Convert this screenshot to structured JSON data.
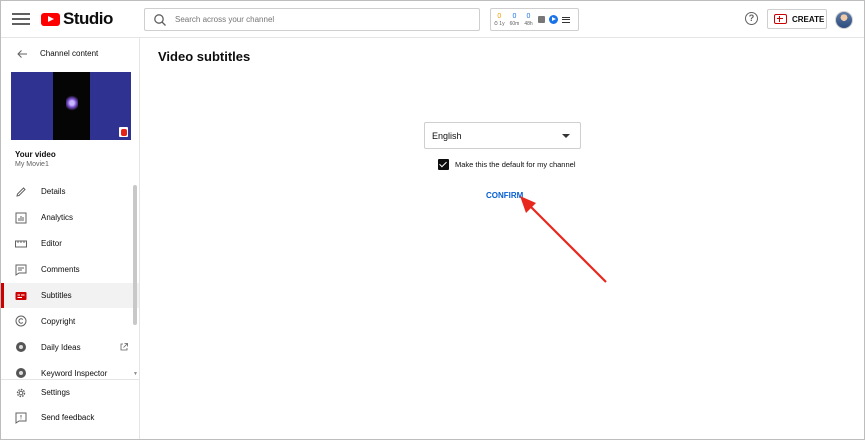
{
  "header": {
    "logo_text": "Studio",
    "search_placeholder": "Search across your channel",
    "stats": [
      {
        "value": "0",
        "label": "⏱ 1y",
        "color": "#f59b00"
      },
      {
        "value": "0",
        "label": "60m",
        "color": "#1a73e8"
      },
      {
        "value": "0",
        "label": "48h",
        "color": "#1a73e8"
      }
    ],
    "help_glyph": "?",
    "create_label": "CREATE"
  },
  "sidebar": {
    "back_label": "Channel content",
    "your_video_label": "Your video",
    "video_title": "My Movie1",
    "items": [
      {
        "label": "Details",
        "icon": "pencil-icon"
      },
      {
        "label": "Analytics",
        "icon": "analytics-icon"
      },
      {
        "label": "Editor",
        "icon": "editor-icon"
      },
      {
        "label": "Comments",
        "icon": "comments-icon"
      },
      {
        "label": "Subtitles",
        "icon": "subtitles-icon",
        "active": true
      },
      {
        "label": "Copyright",
        "icon": "copyright-icon"
      },
      {
        "label": "Daily Ideas",
        "icon": "daily-ideas-icon"
      },
      {
        "label": "Keyword Inspector",
        "icon": "keyword-inspector-icon"
      }
    ],
    "bottom_items": [
      {
        "label": "Settings",
        "icon": "gear-icon"
      },
      {
        "label": "Send feedback",
        "icon": "feedback-icon"
      }
    ]
  },
  "main": {
    "title": "Video subtitles",
    "language_value": "English",
    "default_checkbox_label": "Make this the default for my channel",
    "default_checked": true,
    "confirm_label": "CONFIRM"
  },
  "colors": {
    "brand_red": "#ff0000",
    "active_red": "#cc0000",
    "link_blue": "#065fd4",
    "annotation_arrow": "#e8281e"
  }
}
